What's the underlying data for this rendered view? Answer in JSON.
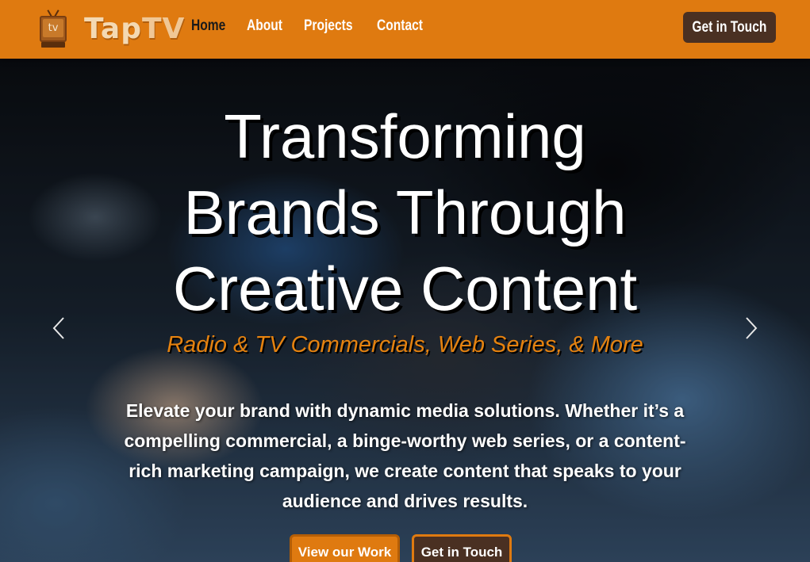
{
  "navbar": {
    "logo_icon_text": "tv",
    "brand_tap": "Tap",
    "brand_tv": "TV",
    "links": [
      {
        "label": "Home",
        "active": true
      },
      {
        "label": "About",
        "active": false
      },
      {
        "label": "Projects",
        "active": false
      },
      {
        "label": "Contact",
        "active": false
      }
    ],
    "cta_label": "Get in Touch"
  },
  "hero": {
    "title_lines": [
      "Transforming",
      "Brands Through",
      "Creative Content"
    ],
    "subtitle": "Radio & TV Commercials, Web Series, & More",
    "description": "Elevate your brand with dynamic media solutions. Whether it’s a compelling commercial, a binge-worthy web series, or a content-rich marketing campaign, we create content that speaks to your audience and drives results.",
    "primary_button": "View our Work",
    "secondary_button": "Get in Touch",
    "prev_icon": "chevron-left-icon",
    "next_icon": "chevron-right-icon"
  },
  "colors": {
    "brand_orange": "#df7a10",
    "dark_brown": "#4a3022",
    "subtitle_orange": "#e5820f"
  }
}
